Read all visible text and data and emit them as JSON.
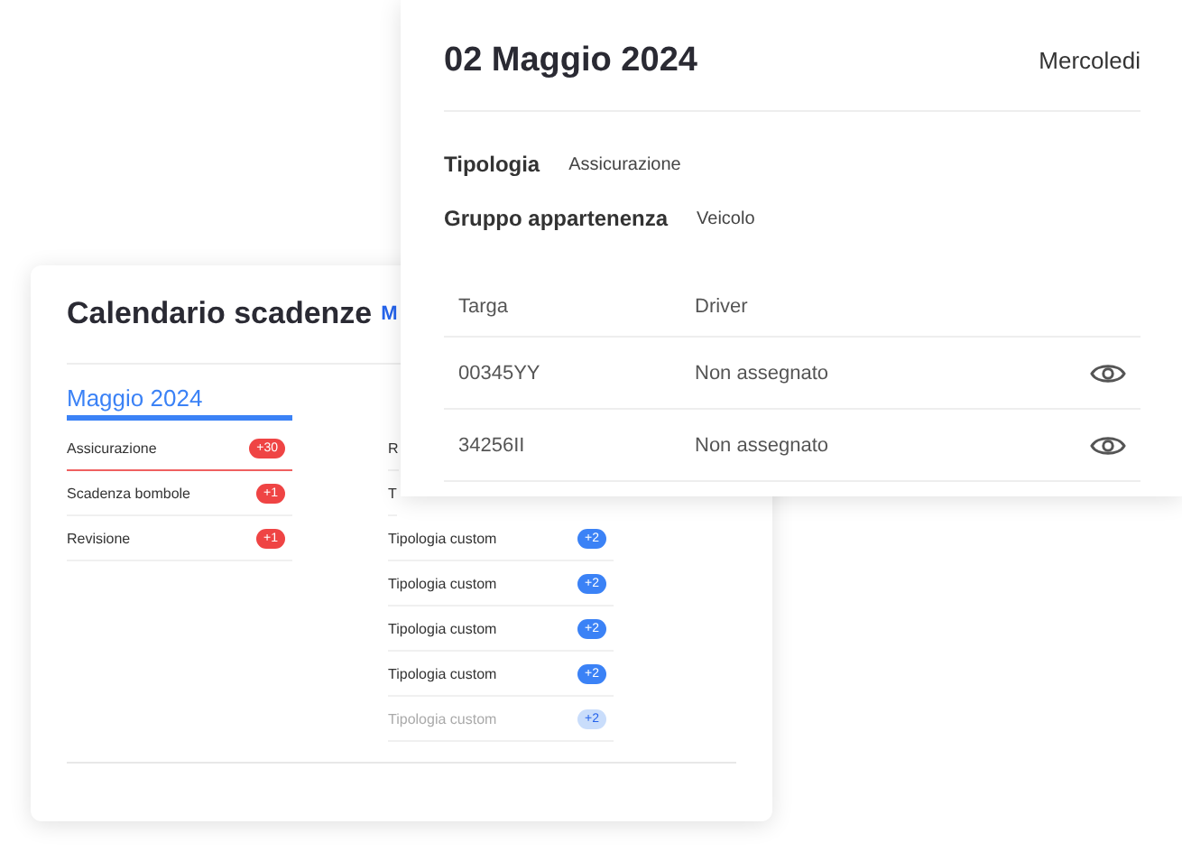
{
  "calendar_card": {
    "title": "Calendario scadenze",
    "next_tab": "M",
    "months": [
      {
        "label": "Maggio 2024",
        "selected": true,
        "items": [
          {
            "label": "Assicurazione",
            "badge": "+30",
            "color": "#ef4444",
            "selected": true,
            "faded": false
          },
          {
            "label": "Scadenza bombole",
            "badge": "+1",
            "color": "#ef4444",
            "selected": false,
            "faded": false
          },
          {
            "label": "Revisione",
            "badge": "+1",
            "color": "#ef4444",
            "selected": false,
            "faded": false
          }
        ]
      },
      {
        "items": [
          {
            "label": "R",
            "selected": false,
            "faded": false
          },
          {
            "label": "T",
            "selected": false,
            "faded": false
          },
          {
            "label": "Tipologia custom",
            "badge": "+2",
            "color": "#3b82f6",
            "selected": false,
            "faded": false
          },
          {
            "label": "Tipologia custom",
            "badge": "+2",
            "color": "#3b82f6",
            "selected": false,
            "faded": false
          },
          {
            "label": "Tipologia custom",
            "badge": "+2",
            "color": "#3b82f6",
            "selected": false,
            "faded": false
          },
          {
            "label": "Tipologia custom",
            "badge": "+2",
            "color": "#3b82f6",
            "selected": false,
            "faded": false
          },
          {
            "label": "Tipologia custom",
            "badge": "+2",
            "color": "#c9ddfb",
            "selected": false,
            "faded": true
          }
        ]
      }
    ]
  },
  "detail_card": {
    "date": "02 Maggio 2024",
    "weekday": "Mercoledi",
    "fields": [
      {
        "label": "Tipologia",
        "value": "Assicurazione"
      },
      {
        "label": "Gruppo appartenenza",
        "value": "Veicolo"
      }
    ],
    "table": {
      "columns": [
        "Targa",
        "Driver"
      ],
      "rows": [
        {
          "targa": "00345YY",
          "driver": "Non assegnato"
        },
        {
          "targa": "34256II",
          "driver": "Non assegnato"
        }
      ]
    }
  }
}
